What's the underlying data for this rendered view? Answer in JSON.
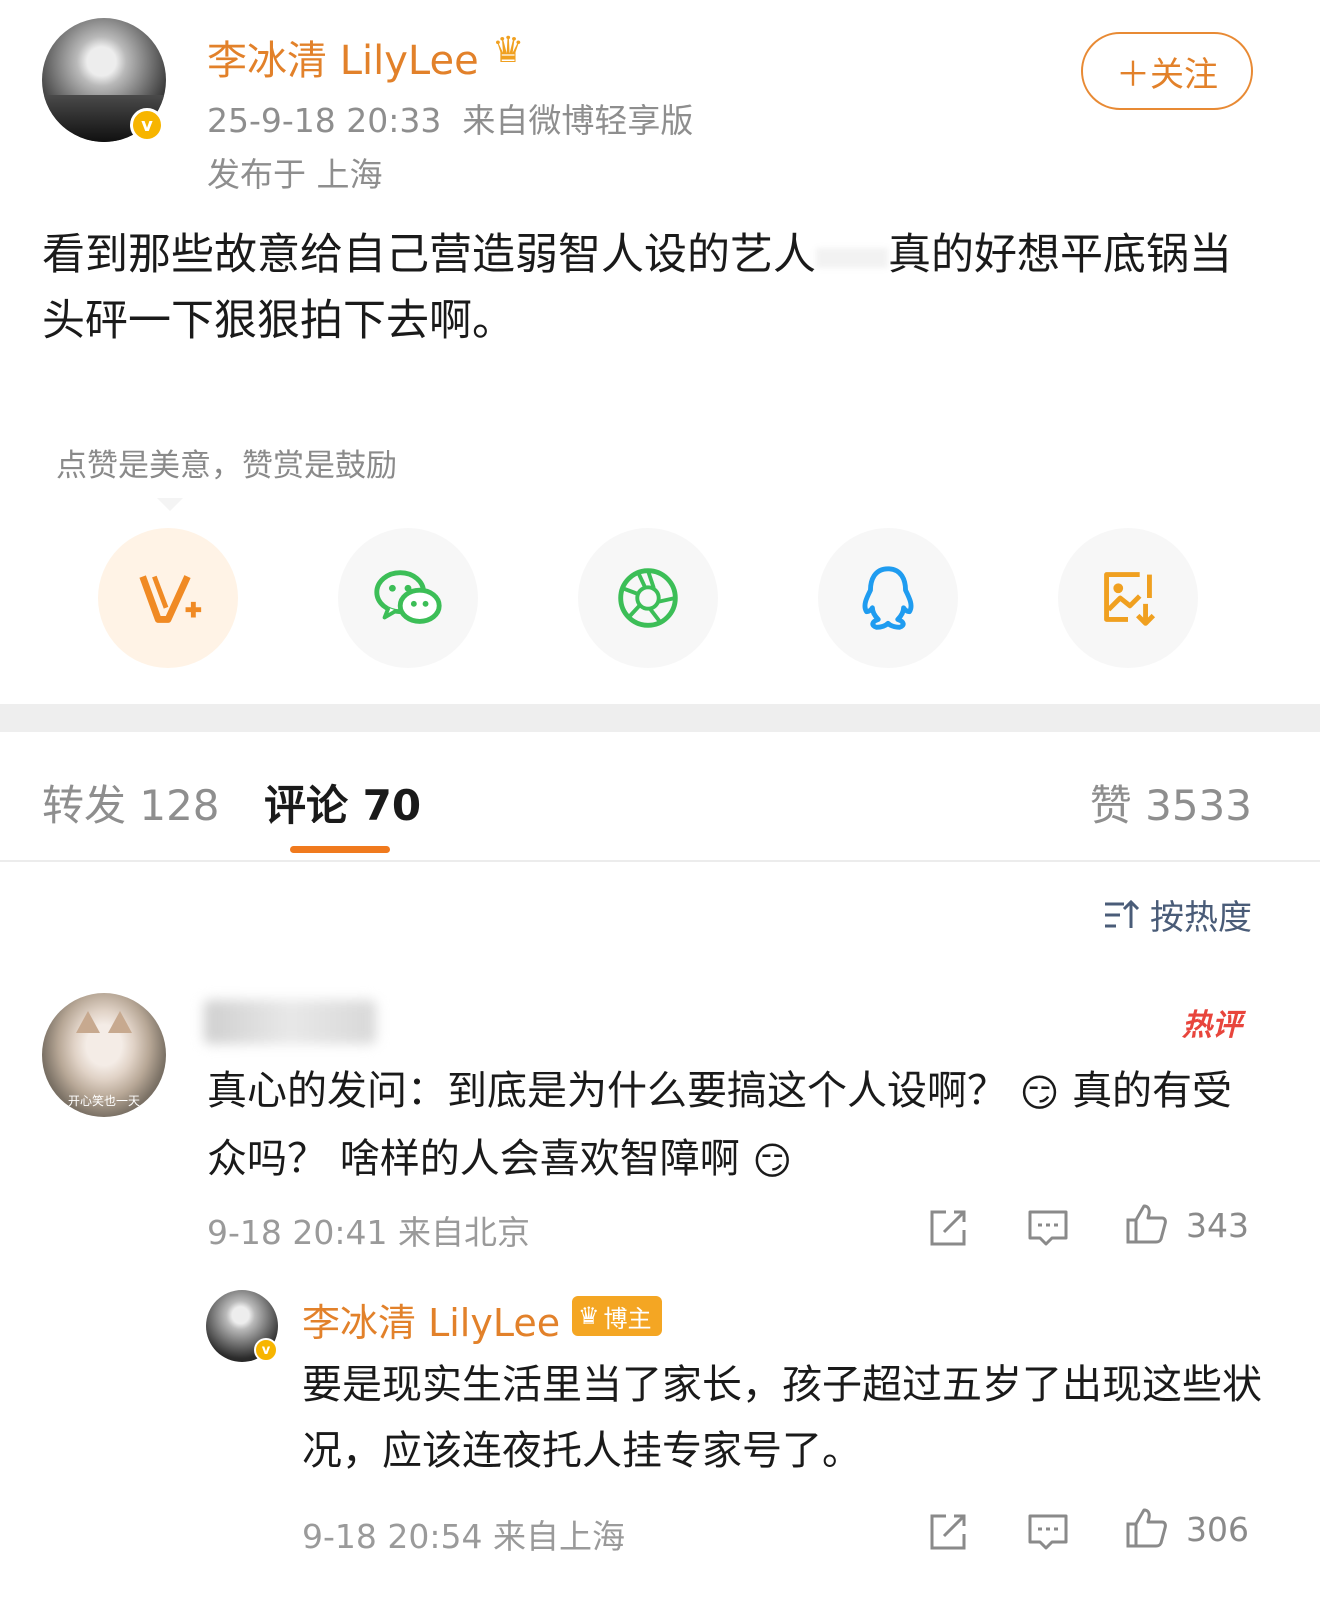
{
  "post": {
    "author_name": "李冰清 LilyLee",
    "time": "25-9-18 20:33",
    "source": "来自微博轻享版",
    "location": "发布于 上海",
    "follow_label": "＋关注",
    "text_part1": "看到那些故意给自己营造弱智人设的艺人",
    "text_part2": "真的好想平底锅当头砰一下狠狠拍下去啊。"
  },
  "reward": {
    "tip": "点赞是美意，赞赏是鼓励"
  },
  "share": {
    "items": [
      {
        "icon": "reward-v-icon",
        "color": "#f08a24"
      },
      {
        "icon": "wechat-icon",
        "color": "#3cbe57"
      },
      {
        "icon": "moments-icon",
        "color": "#3cbe57"
      },
      {
        "icon": "qq-icon",
        "color": "#1f9cf0"
      },
      {
        "icon": "save-image-icon",
        "color": "#f0a020"
      }
    ]
  },
  "tabs": {
    "repost": "转发 128",
    "comments": "评论 70",
    "likes": "赞 3533",
    "active": "comments"
  },
  "sort": {
    "label": "按热度"
  },
  "comment": {
    "hot_label": "热评",
    "text_part1": "真心的发问：到底是为什么要搞这个人设啊？",
    "text_part2": "真的有受众吗？ 啥样的人会喜欢智障啊",
    "time_source": "9-18 20:41 来自北京",
    "likes": "343",
    "avatar_caption": "开心笑也一天"
  },
  "reply": {
    "author_name": "李冰清 LilyLee",
    "badge": "博主",
    "text": "要是现实生活里当了家长，孩子超过五岁了出现这些状况，应该连夜托人挂专家号了。",
    "time_source": "9-18 20:54 来自上海",
    "likes": "306"
  },
  "colors": {
    "accent": "#e2812a",
    "tab_underline": "#f07a1e",
    "hot": "#e8453c",
    "verified": "#f7b500"
  }
}
